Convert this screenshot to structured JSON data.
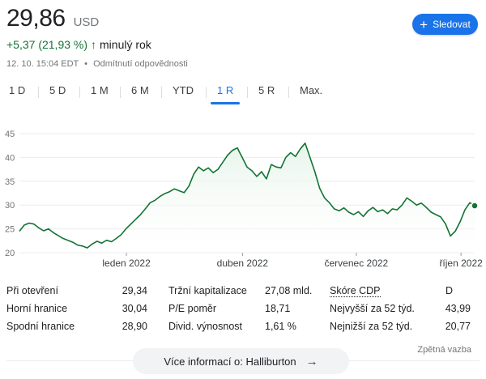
{
  "quote": {
    "price": "29,86",
    "currency": "USD",
    "change": "+5,37 (21,93 %)",
    "change_arrow": "↑",
    "change_period": "minulý rok",
    "timestamp": "12. 10. 15:04 EDT",
    "separator": "•",
    "disclaimer": "Odmítnutí odpovědnosti"
  },
  "follow_button": {
    "label": "Sledovat",
    "icon": "plus-icon"
  },
  "tabs": [
    {
      "label": "1 D",
      "active": false
    },
    {
      "label": "5 D",
      "active": false
    },
    {
      "label": "1 M",
      "active": false
    },
    {
      "label": "6 M",
      "active": false
    },
    {
      "label": "YTD",
      "active": false
    },
    {
      "label": "1 R",
      "active": true
    },
    {
      "label": "5 R",
      "active": false
    },
    {
      "label": "Max.",
      "active": false
    }
  ],
  "chart_data": {
    "type": "area",
    "ylim": [
      20,
      45
    ],
    "yticks": [
      "20",
      "25",
      "30",
      "35",
      "40",
      "45"
    ],
    "xtick_labels": [
      "leden 2022",
      "duben 2022",
      "červenec 2022",
      "říjen 2022"
    ],
    "xtick_positions": [
      0.235,
      0.49,
      0.74,
      0.97
    ],
    "line_color": "#137333",
    "fill_color": "#e6f4ea",
    "values": [
      24.5,
      25.8,
      26.2,
      26.0,
      25.2,
      24.6,
      25.0,
      24.2,
      23.6,
      23.0,
      22.6,
      22.2,
      21.6,
      21.4,
      21.0,
      21.8,
      22.4,
      22.0,
      22.6,
      22.3,
      23.0,
      23.8,
      25.0,
      26.0,
      27.0,
      28.0,
      29.2,
      30.5,
      31.0,
      31.8,
      32.4,
      32.8,
      33.4,
      33.0,
      32.6,
      34.0,
      36.5,
      38.0,
      37.2,
      37.8,
      36.8,
      37.5,
      39.0,
      40.5,
      41.5,
      42.0,
      40.0,
      38.0,
      37.2,
      36.0,
      37.0,
      35.5,
      38.5,
      38.0,
      37.8,
      40.0,
      41.0,
      40.2,
      41.8,
      43.0,
      40.0,
      37.0,
      33.5,
      31.5,
      30.5,
      29.2,
      28.8,
      29.4,
      28.5,
      28.0,
      28.6,
      27.6,
      28.8,
      29.5,
      28.6,
      29.0,
      28.2,
      29.2,
      29.0,
      30.0,
      31.5,
      30.8,
      30.0,
      30.4,
      29.5,
      28.5,
      28.0,
      27.5,
      26.0,
      23.5,
      24.5,
      26.5,
      29.0,
      30.5,
      29.86
    ]
  },
  "stats": {
    "col1": [
      {
        "label": "Při otevření",
        "value": "29,34"
      },
      {
        "label": "Horní hranice",
        "value": "30,04"
      },
      {
        "label": "Spodní hranice",
        "value": "28,90"
      }
    ],
    "col2": [
      {
        "label": "Tržní kapitalizace",
        "value": "27,08 mld."
      },
      {
        "label": "P/E poměr",
        "value": "18,71"
      },
      {
        "label": "Divid. výnosnost",
        "value": "1,61 %"
      }
    ],
    "col3": [
      {
        "label": "Skóre CDP",
        "value": "D"
      },
      {
        "label": "Nejvyšší za 52 týd.",
        "value": "43,99"
      },
      {
        "label": "Nejnižší za 52 týd.",
        "value": "20,77"
      }
    ]
  },
  "more_info": {
    "label": "Více informací o: Halliburton",
    "icon": "arrow-right-icon"
  },
  "feedback": "Zpětná vazba"
}
